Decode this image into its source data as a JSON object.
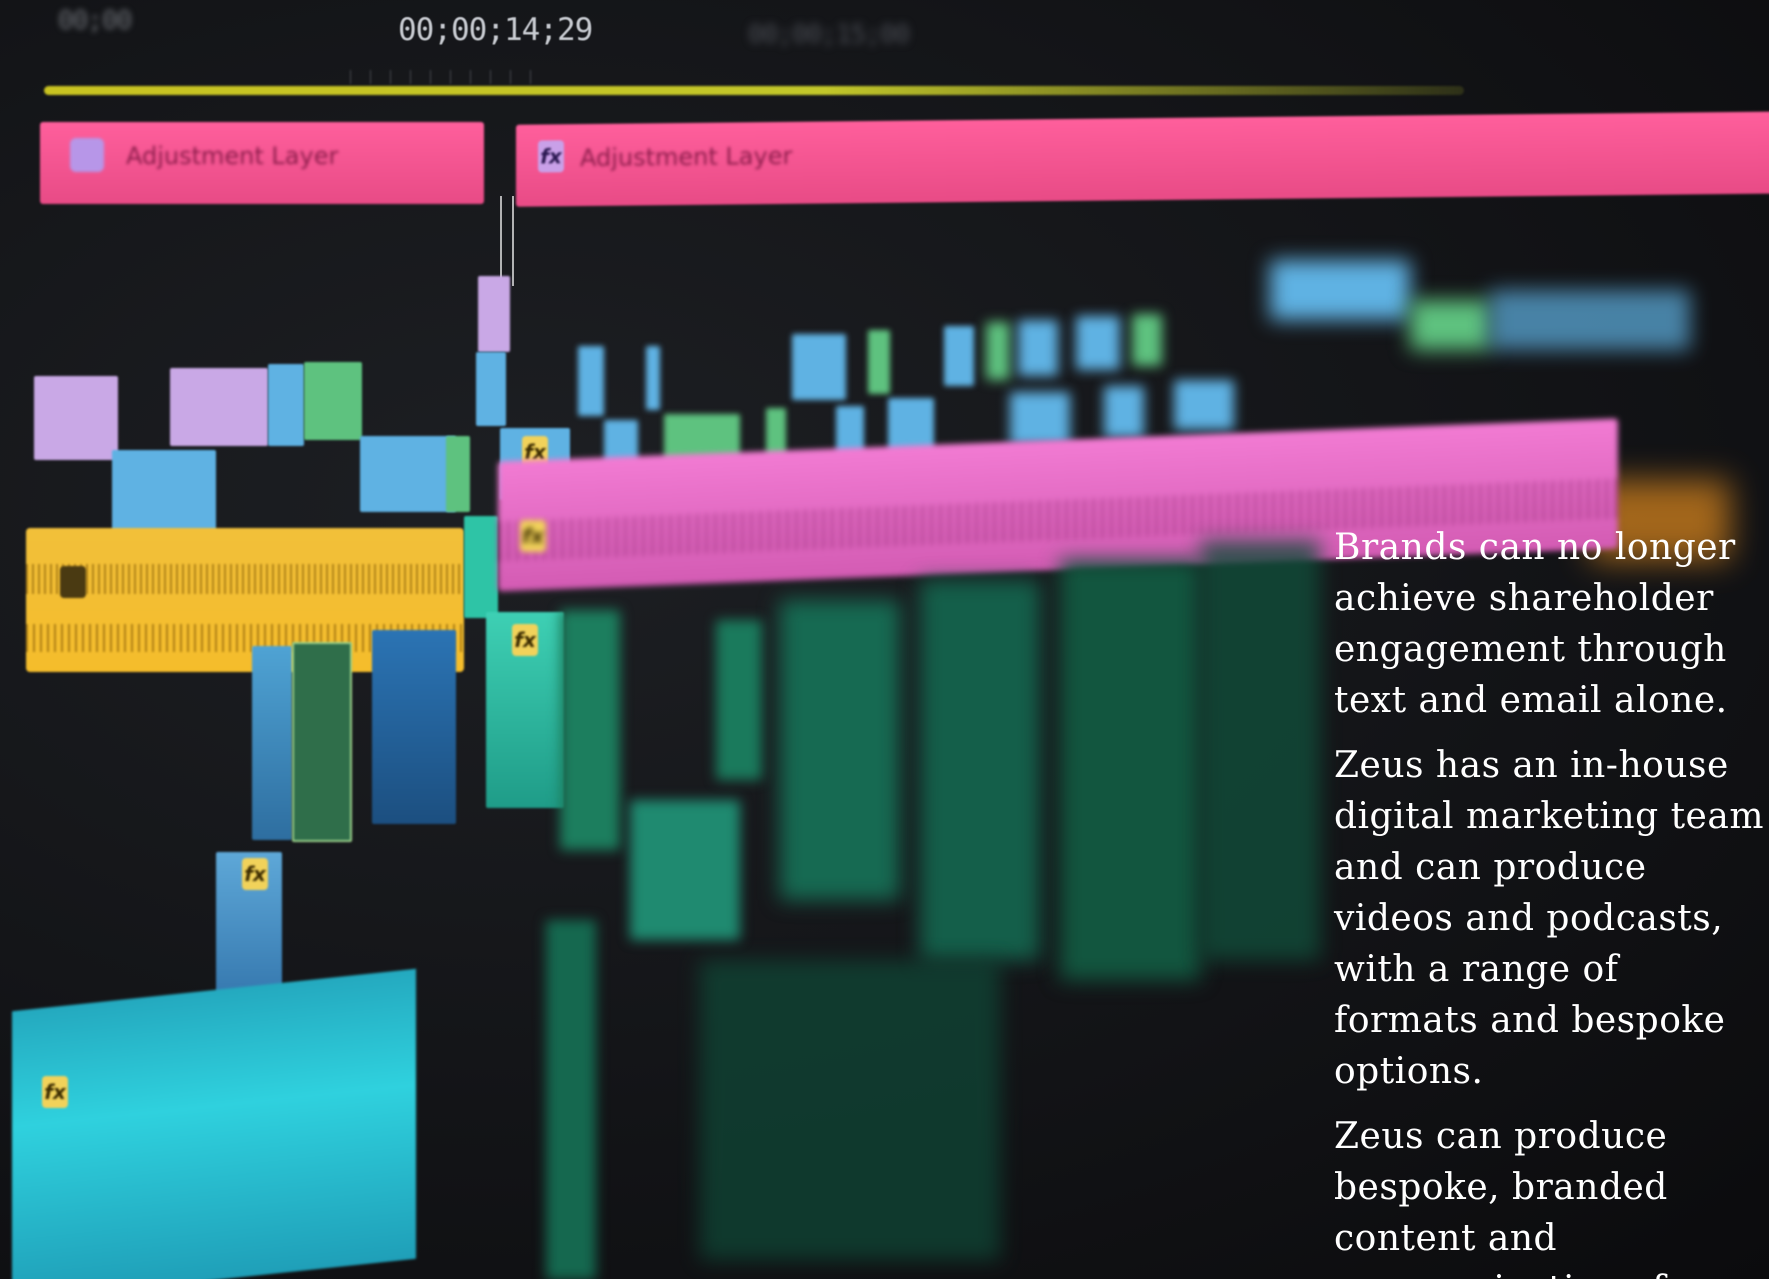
{
  "timeline": {
    "timecode_main": "00;00;14;29",
    "timecode_left": "00;00",
    "timecode_far": "00;00;15;00"
  },
  "adjustment_layers": [
    {
      "label": "Adjustment Layer"
    },
    {
      "label": "Adjustment Layer"
    }
  ],
  "fx_badge": "fx",
  "copy": {
    "paragraphs": [
      "Brands can no longer achieve shareholder engagement through text and email alone.",
      "Zeus has an in-house digital marketing team and can produce videos and podcasts, with a range of formats and bespoke options.",
      "Zeus can produce bespoke, branded content and communications for"
    ]
  },
  "colors": {
    "background": "#111214",
    "adjustment_layer": "#ff5f9c",
    "work_area_bar": "#c9c321",
    "audio_yellow": "#f5bd2b",
    "audio_pink": "#f06ec8",
    "audio_cyan": "#2fd1de",
    "text": "#ffffff"
  }
}
